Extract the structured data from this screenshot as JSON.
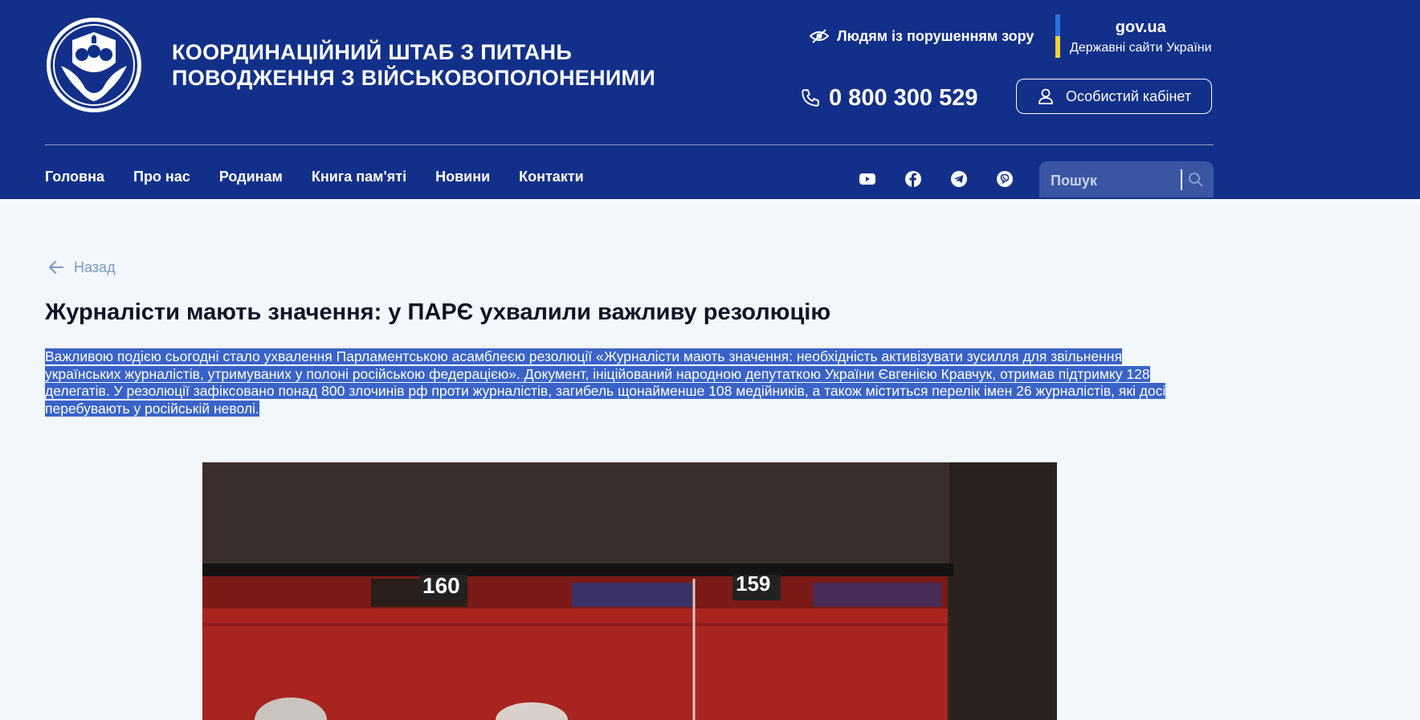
{
  "header": {
    "title_line1": "Координаційний штаб з питань",
    "title_line2": "поводження з військовополоненими",
    "accessibility_label": "Людям із порушенням зору",
    "gov_name": "gov.ua",
    "gov_sub": "Державні сайти України",
    "phone": "0 800 300 529",
    "cabinet_label": "Особистий кабінет",
    "colors": {
      "background": "#123089",
      "gov_flag_blue": "#2f6fe0",
      "gov_flag_yellow": "#f0d43a"
    }
  },
  "nav": {
    "items": [
      {
        "label": "Головна"
      },
      {
        "label": "Про нас"
      },
      {
        "label": "Родинам"
      },
      {
        "label": "Книга пам'яті"
      },
      {
        "label": "Новини"
      },
      {
        "label": "Контакти"
      }
    ]
  },
  "social": {
    "icons": [
      "youtube-icon",
      "facebook-icon",
      "telegram-icon",
      "viber-icon"
    ]
  },
  "search": {
    "placeholder": "Пошук"
  },
  "article": {
    "back_label": "Назад",
    "title": "Журналісти мають значення: у ПАРЄ ухвалили важливу резолюцію",
    "lead": "Важливою подією сьогодні стало ухвалення Парламентською асамблеєю резолюції «Журналісти мають значення: необхідність активізувати зусилля для звільнення українських журналістів, утримуваних у полоні російською федерацією». Документ, ініційований народною депутаткою України Євгенією Кравчук, отримав підтримку 128 делегатів. У резолюції зафіксовано понад 800 злочинів рф проти журналістів, загибель щонайменше 108 медійників, а також міститься перелік імен 26 журналістів, які досі перебувають у російській неволі.",
    "photo_seat_numbers": [
      "160",
      "159"
    ]
  }
}
